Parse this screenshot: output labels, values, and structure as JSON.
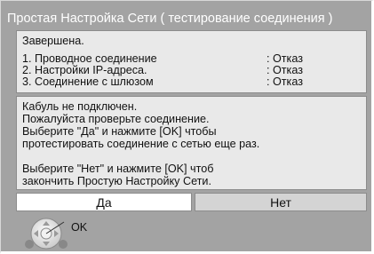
{
  "dialog": {
    "title": "Простая Настройка Сети ( тестирование соединения )"
  },
  "status": {
    "text": "Завершена.",
    "results": [
      {
        "label": "1. Проводное соединение",
        "value": ": Отказ"
      },
      {
        "label": "2. Настройки IP-адреса.",
        "value": ": Отказ"
      },
      {
        "label": "3. Соединение с шлюзом",
        "value": ": Отказ"
      }
    ]
  },
  "message": {
    "lines": [
      "Кабуль не подключен.",
      "Пожалуйста проверьте соединение.",
      "Выберите \"Да\" и нажмите [OK] чтобы",
      "протестировать соединение с сетью еще раз.",
      "",
      "Выберите \"Нет\" и нажмите [OK] чтоб",
      "закончить Простую Настройку Сети."
    ]
  },
  "buttons": {
    "yes_label": "Да",
    "no_label": "Нет"
  },
  "hint": {
    "icon": "remote-dpad-icon",
    "label": "OK"
  },
  "colors": {
    "background": "#a3a3a3",
    "panel": "#e9e9e9",
    "selected_button": "#ffffff",
    "unselected_button": "#d4d4d4"
  }
}
